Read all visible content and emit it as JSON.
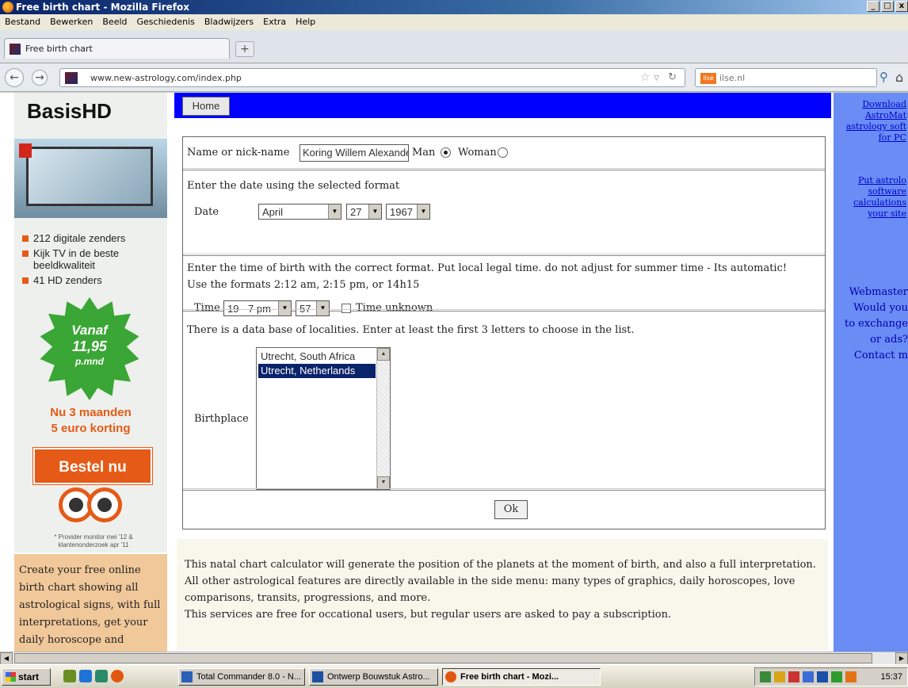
{
  "window": {
    "title": "Free birth chart - Mozilla Firefox",
    "controls": [
      "_",
      "□",
      "x"
    ]
  },
  "menubar": [
    "Bestand",
    "Bewerken",
    "Beeld",
    "Geschiedenis",
    "Bladwijzers",
    "Extra",
    "Help"
  ],
  "tab": {
    "title": "Free birth chart",
    "new_tab": "+"
  },
  "nav": {
    "url": "www.new-astrology.com/index.php",
    "search_engine_badge": "ilse",
    "search_placeholder": "ilse.nl"
  },
  "left_ad": {
    "logo": "BasisHD",
    "features": [
      "212 digitale zenders",
      "Kijk TV in de beste beeldkwaliteit",
      "41 HD zenders"
    ],
    "price_line1": "Vanaf",
    "price_line2": "11,95",
    "price_line3": "p.mnd",
    "promo_line1": "Nu 3 maanden",
    "promo_line2": "5 euro korting",
    "cta": "Bestel nu",
    "footnote": "* Provider monitor mei '12 & klantenonderzoek apr '11"
  },
  "left_text": "Create your free online birth chart showing all astrological signs, with full interpretations, get your daily horoscope and",
  "center": {
    "home_button": "Home"
  },
  "form": {
    "name_label": "Name or nick-name",
    "name_value": "Koring Willem Alexander",
    "man_label": "Man",
    "woman_label": "Woman",
    "date_instruction": "Enter the date using the selected format",
    "date_label": "Date",
    "month_value": "April",
    "day_value": "27",
    "year_value": "1967",
    "time_instruction_line1": "Enter the time of birth with the correct format. Put local legal time. do not adjust for summer time - Its automatic!",
    "time_instruction_line2": "Use the formats 2:12 am, 2:15 pm, or 14h15",
    "time_section": {
      "label": "Time",
      "time_select_value": "19 - 7 pm",
      "minute_select_value": "57",
      "unknown_label": "Time unknown"
    },
    "locality_instruction": "There is a data base of localities. Enter at least the first 3 letters to choose in the list.",
    "birthplace_label": "Birthplace",
    "places": [
      "Utrecht, South Africa",
      "Utrecht, Netherlands"
    ],
    "ok_label": "Ok"
  },
  "description": [
    "This natal chart calculator will generate the position of the planets at the moment of birth, and also a full interpretation.",
    "All other astrological features are directly available in the side menu: many types of graphics, daily horoscopes, love",
    "comparisons, transits, progressions, and more.",
    "This services are free for occational users, but regular users are asked to pay a subscription."
  ],
  "right": {
    "link1": [
      "Download",
      "AstroMat",
      "astrology soft",
      "for PC"
    ],
    "link2": [
      "Put astrolo",
      "software",
      "calculations",
      "your site"
    ],
    "webmaster": [
      "Webmaster",
      "Would you",
      "to exchange",
      "or ads?",
      "Contact m"
    ]
  },
  "taskbar": {
    "start": "start",
    "tasks": [
      "Total Commander 8.0 - N...",
      "Ontwerp Bouwstuk Astro...",
      "Free birth chart - Mozi..."
    ],
    "clock": "15:37"
  },
  "colors": {
    "page_blue_bar": "#0000ff",
    "right_sidebar": "#6a8cf5",
    "ad_orange": "#e55a16",
    "ad_green": "#3aa635"
  }
}
